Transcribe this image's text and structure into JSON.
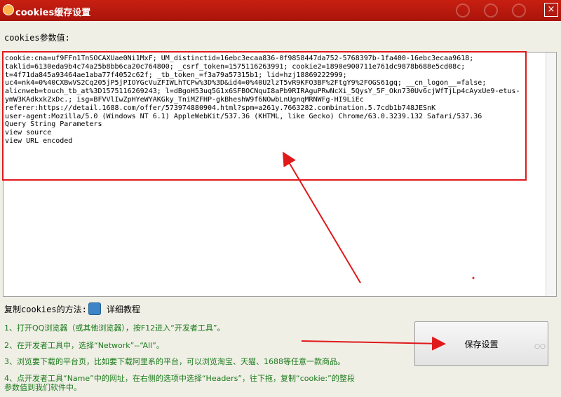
{
  "window": {
    "title": "cookies缓存设置",
    "close_label": "×"
  },
  "params_label": "cookies参数值:",
  "textarea_lines": [
    "cookie:cna=uf9FFn1TnSOCAXUae0Ni1MxF; UM_distinctid=16ebc3ecaa836-0f9858447da752-5768397b-1fa400-16ebc3ecaa9618;",
    "taklid=6130eda9b4c74a25b8bb6ca20c764800; _csrf_token=1575116263991; cookie2=1890e900711e761dc9878b688e5cd08c;",
    "t=4f71da845a93464ae1aba77f4052c62f; _tb_token_=f3a79a57315b1; lid=hzj18869222999;",
    "uc4=nk4=0%40CXBwVS2Cq205jP5jPIOYGcVuZFIWLhTCPw%3D%3D&id4=0%40U2lzT5vR9KFO3BF%2FtgY9%2FOGS61gq; __cn_logon__=false;",
    "alicnweb=touch_tb_at%3D1575116269243; l=dBgoH53uq5G1x6SFBOCNquI8aPb9RIRAguPRwNcXi_5QysY_5F_Okn730Uv6cjWfTjLp4cAyxUe9-etus-",
    "ymW3KAdkxkZxDc.; isg=BFVVlIwZpHYeWYAKGky_TniMZFHP-gkBheshW9f6NOwbLnUgnqMRNWFg-HI9LiEc",
    "referer:https://detail.1688.com/offer/573974880904.html?spm=a261y.7663282.combination.5.7cdb1b748JESnK",
    "user-agent:Mozilla/5.0 (Windows NT 6.1) AppleWebKit/537.36 (KHTML, like Gecko) Chrome/63.0.3239.132 Safari/537.36",
    "Query String Parameters",
    "view source",
    "view URL encoded"
  ],
  "how_label": "复制cookies的方法:",
  "tutorial_link": "详细教程",
  "steps": [
    "1、打开QQ浏览器（或其他浏览器），按F12进入“开发者工具”。",
    "2、在开发者工具中，选择“Network”--“All”。",
    "3、浏览要下载的平台页，比如要下载阿里系的平台，可以浏览淘宝、天猫、1688等任意一款商品。",
    "4、点开发者工具“Name”中的网址，在右侧的选项中选择“Headers”，往下拖，复制“cookie:”的整段",
    "参数值到我们软件中。"
  ],
  "save_button": "保存设置",
  "colors": {
    "titlebar": "#b5180c",
    "highlight": "#e0191b",
    "step_text": "#1a7a1a"
  }
}
